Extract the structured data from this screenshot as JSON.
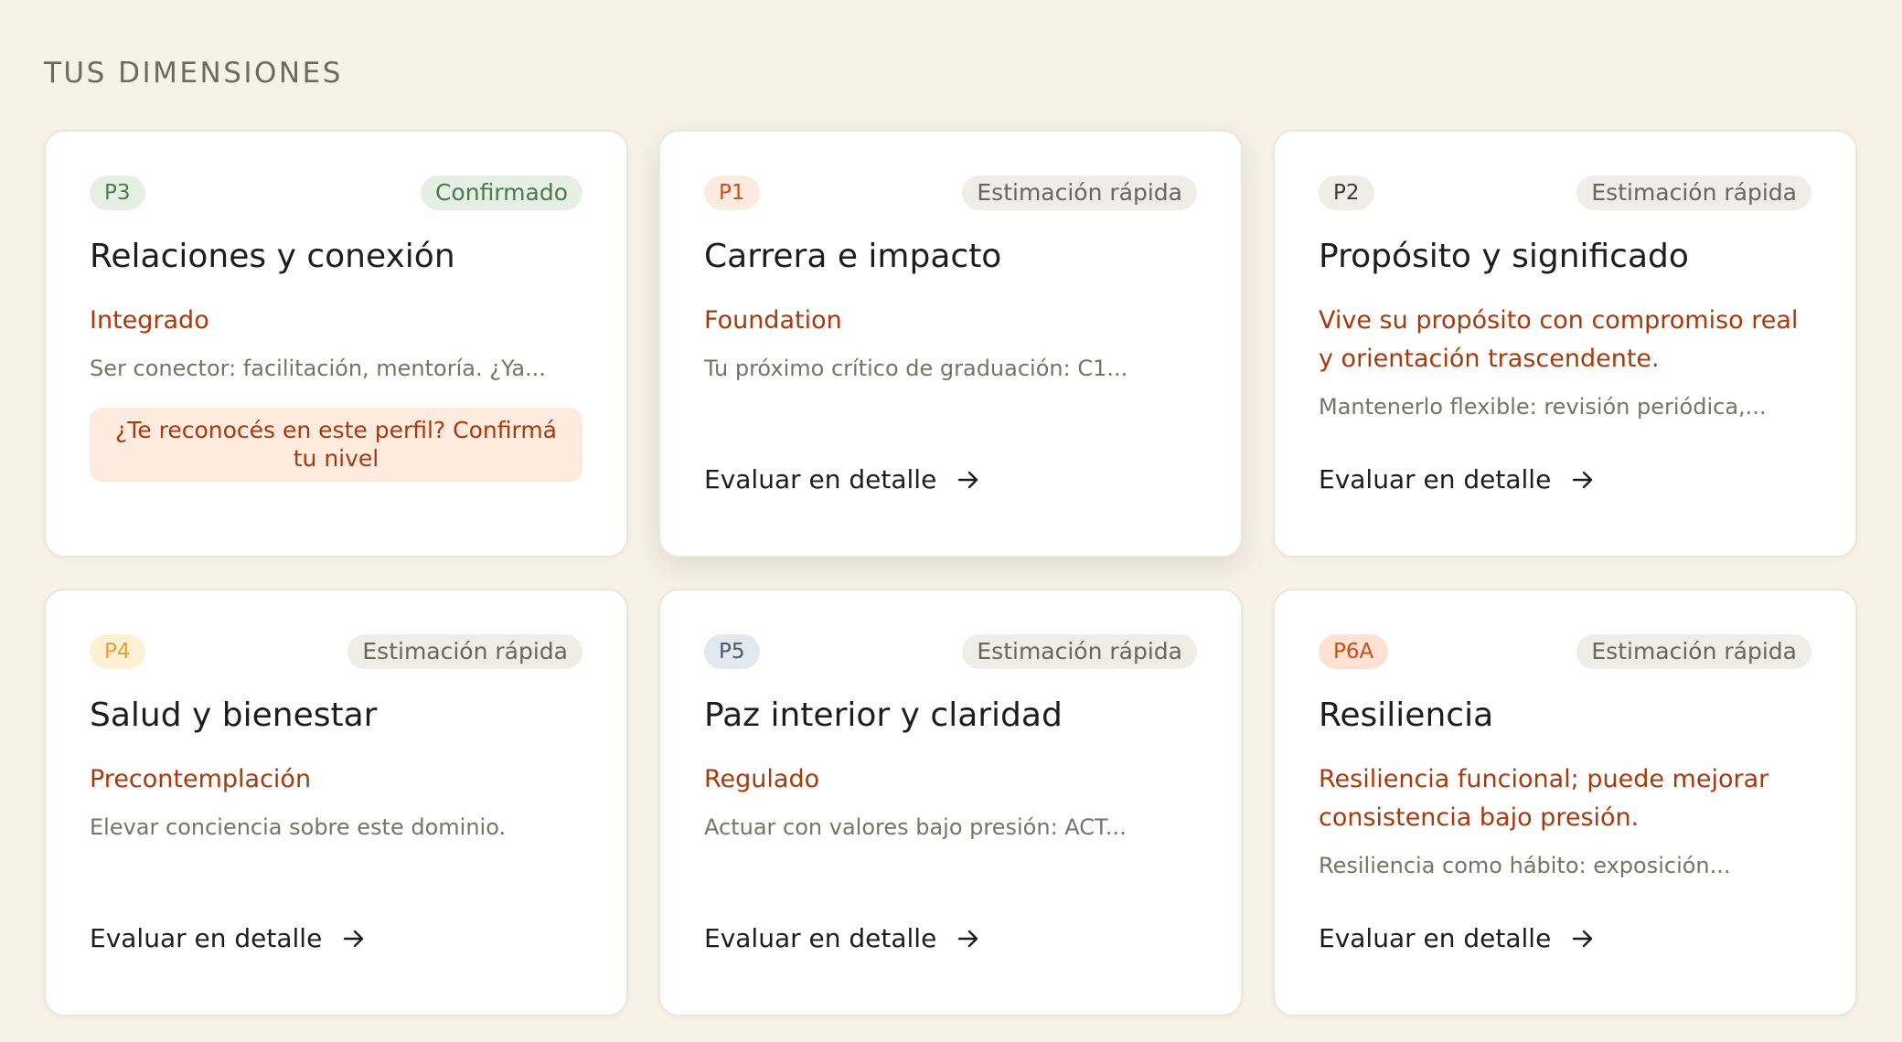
{
  "section": {
    "title": "TUS DIMENSIONES"
  },
  "cards": [
    {
      "code": "P3",
      "code_bg": "#e6efe4",
      "code_fg": "#4a7a50",
      "status": "Confirmado",
      "title": "Relaciones y conexión",
      "level": "Integrado",
      "description": "Ser conector: facilitación, mentoría. ¿Ya...",
      "confirm_prompt": "¿Te reconocés en este perfil? Confirmá tu nivel"
    },
    {
      "code": "P1",
      "code_bg": "#fdebe0",
      "code_fg": "#c4511b",
      "status": "Estimación rápida",
      "title": "Carrera e impacto",
      "level": "Foundation",
      "description": "Tu próximo crítico de graduación: C1...",
      "action": "Evaluar en detalle",
      "action_icon": "arrow-right-icon"
    },
    {
      "code": "P2",
      "code_bg": "#efede8",
      "code_fg": "#3a3a36",
      "status": "Estimación rápida",
      "title": "Propósito y significado",
      "level": "Vive su propósito con compromiso real y orientación trascendente.",
      "description": "Mantenerlo flexible: revisión periódica,...",
      "action": "Evaluar en detalle",
      "action_icon": "arrow-right-icon"
    },
    {
      "code": "P4",
      "code_bg": "#fdf0d4",
      "code_fg": "#e0a23a",
      "status": "Estimación rápida",
      "title": "Salud y bienestar",
      "level": "Precontemplación",
      "description": "Elevar conciencia sobre este dominio.",
      "action": "Evaluar en detalle",
      "action_icon": "arrow-right-icon"
    },
    {
      "code": "P5",
      "code_bg": "#e3e8ee",
      "code_fg": "#4b5867",
      "status": "Estimación rápida",
      "title": "Paz interior y claridad",
      "level": "Regulado",
      "description": "Actuar con valores bajo presión: ACT...",
      "action": "Evaluar en detalle",
      "action_icon": "arrow-right-icon"
    },
    {
      "code": "P6A",
      "code_bg": "#fde1d3",
      "code_fg": "#c4511b",
      "status": "Estimación rápida",
      "title": "Resiliencia",
      "level": "Resiliencia funcional; puede mejorar consistencia bajo presión.",
      "description": "Resiliencia como hábito: exposición...",
      "action": "Evaluar en detalle",
      "action_icon": "arrow-right-icon"
    }
  ]
}
